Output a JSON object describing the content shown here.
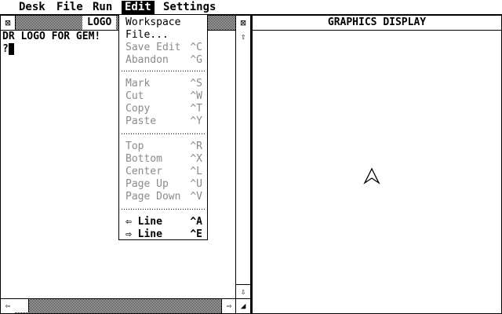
{
  "menubar": {
    "items": [
      "Desk",
      "File",
      "Run",
      "Edit",
      "Settings"
    ],
    "active": "Edit"
  },
  "logo_window": {
    "title": "LOGO",
    "lines": [
      "DR LOGO FOR GEM!",
      "?"
    ],
    "close_icon": "close-box-icon",
    "full_icon": "full-box-icon"
  },
  "graphics_window": {
    "title": "GRAPHICS DISPLAY"
  },
  "edit_menu": {
    "group1": [
      {
        "label": "Workspace",
        "shortcut": "",
        "enabled": true
      },
      {
        "label": "File...",
        "shortcut": "",
        "enabled": true
      },
      {
        "label": "Save Edit",
        "shortcut": "^C",
        "enabled": false
      },
      {
        "label": "Abandon",
        "shortcut": "^G",
        "enabled": false
      }
    ],
    "group2": [
      {
        "label": "Mark",
        "shortcut": "^S",
        "enabled": false
      },
      {
        "label": "Cut",
        "shortcut": "^W",
        "enabled": false
      },
      {
        "label": "Copy",
        "shortcut": "^T",
        "enabled": false
      },
      {
        "label": "Paste",
        "shortcut": "^Y",
        "enabled": false
      }
    ],
    "group3": [
      {
        "label": "Top",
        "shortcut": "^R",
        "enabled": false
      },
      {
        "label": "Bottom",
        "shortcut": "^X",
        "enabled": false
      },
      {
        "label": "Center",
        "shortcut": "^L",
        "enabled": false
      },
      {
        "label": "Page Up",
        "shortcut": "^U",
        "enabled": false
      },
      {
        "label": "Page Down",
        "shortcut": "^V",
        "enabled": false
      }
    ],
    "group4": [
      {
        "label": "Line",
        "shortcut": "^A",
        "enabled": true,
        "arrow": "left"
      },
      {
        "label": "Line",
        "shortcut": "^E",
        "enabled": true,
        "arrow": "right"
      }
    ]
  }
}
